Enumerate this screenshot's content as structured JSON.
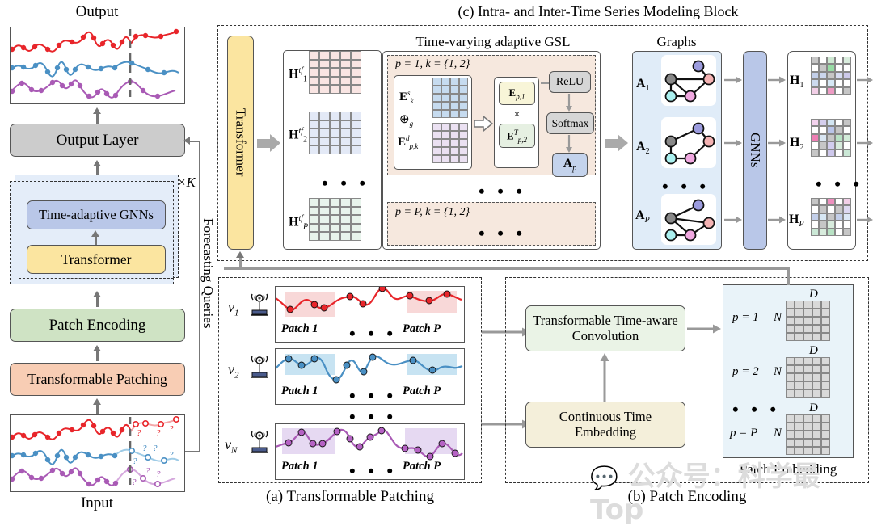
{
  "figure": {
    "left_flow": {
      "output_label": "Output",
      "input_label": "Input",
      "output_layer": "Output Layer",
      "time_adaptive_gnns": "Time-adaptive GNNs",
      "transformer": "Transformer",
      "patch_encoding": "Patch Encoding",
      "transformable_patching": "Transformable Patching",
      "repeat_k": "×K",
      "forecasting_queries": "Forecasting Queries"
    },
    "panel_c": {
      "title": "(c) Intra- and Inter-Time Series Modeling Block",
      "transformer_label": "Transformer",
      "h_tf": [
        "H",
        "H",
        "H"
      ],
      "h_tf_sub": [
        "1",
        "2",
        "P"
      ],
      "h_tf_sup": "tf",
      "gsl_title": "Time-varying adaptive GSL",
      "gsl_block1_header": "p = 1, k = {1, 2}",
      "gsl_blockP_header": "p = P, k = {1, 2}",
      "e_s_k": "E",
      "e_s_k_sup": "s",
      "e_s_k_sub": "k",
      "oplus_g": "⊕",
      "oplus_g_sub": "g",
      "e_d_pk": "E",
      "e_d_pk_sup": "d",
      "e_d_pk_sub": "p,k",
      "e_p1": "E",
      "e_p1_sub": "p,1",
      "times": "×",
      "e_p2T": "E",
      "e_p2T_sup": "T",
      "e_p2T_sub": "p,2",
      "relu": "ReLU",
      "softmax": "Softmax",
      "a_p": "A",
      "a_p_sub": "p",
      "graphs_title": "Graphs",
      "adj": [
        "A",
        "A",
        "A"
      ],
      "adj_sub": [
        "1",
        "2",
        "P"
      ],
      "gnns_label": "GNNs",
      "h_out": [
        "H",
        "H",
        "H"
      ],
      "h_out_sub": [
        "1",
        "2",
        "P"
      ],
      "ellipsis": "• • •"
    },
    "panel_a": {
      "title": "(a) Transformable Patching",
      "nodes": [
        "v",
        "v",
        "v"
      ],
      "node_subs": [
        "1",
        "2",
        "N"
      ],
      "patch_first": "Patch 1",
      "patch_last": "Patch P",
      "ellipsis": "• • •",
      "sensor_icon": "sensor-icon"
    },
    "panel_b": {
      "title": "(b) Patch Encoding",
      "conv_box": "Transformable Time-aware Convolution",
      "time_embed_box": "Continuous Time Embedding",
      "patch_embedding_label": "Patch Embedding",
      "rows": [
        {
          "p": "p = 1",
          "n": "N",
          "d": "D"
        },
        {
          "p": "p = 2",
          "n": "N",
          "d": "D"
        },
        {
          "p": "p = P",
          "n": "N",
          "d": "D"
        }
      ],
      "ellipsis": "• • •"
    },
    "watermark": "公众号：科学最Top",
    "colors": {
      "series_red": "#e8252a",
      "series_blue": "#4a90c4",
      "series_purple": "#a95ab5",
      "yellow_box": "#fbe5a0",
      "blue_box": "#b9c7e8",
      "green_box": "#cfe3c4",
      "orange_box": "#f8cdb4",
      "grey_box": "#cccccc",
      "light_blue_panel": "#e4edf9",
      "beige_panel": "#f6e8de",
      "mint_box": "#eaf3e6",
      "cream_box": "#f4efda",
      "pale_blue_panel": "#e9f3f9"
    }
  }
}
